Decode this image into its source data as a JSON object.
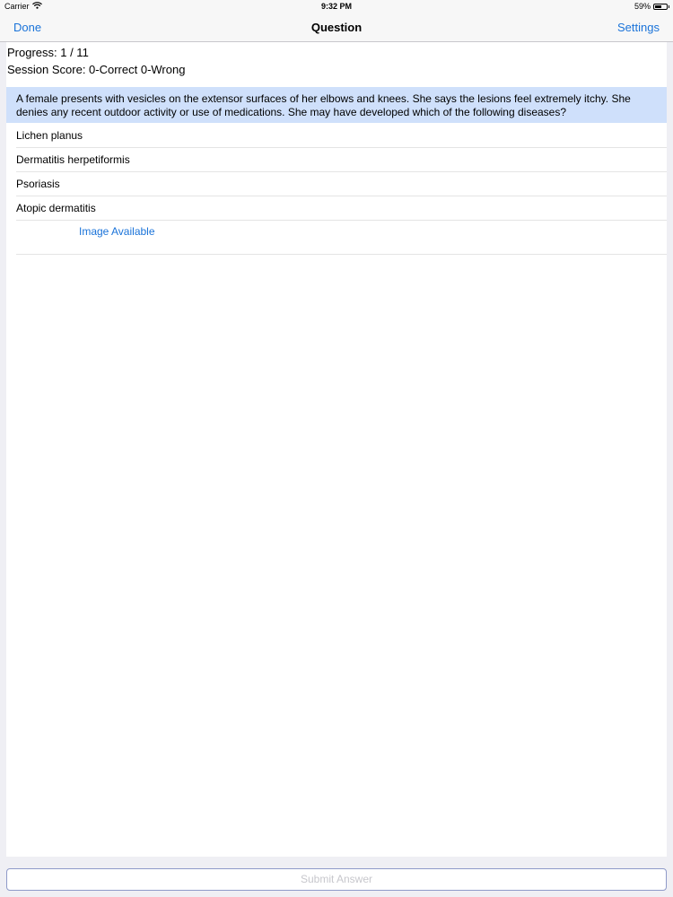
{
  "status": {
    "carrier": "Carrier",
    "time": "9:32 PM",
    "battery": "59%",
    "battery_level": 0.59
  },
  "nav": {
    "left_label": "Done",
    "title": "Question",
    "right_label": "Settings"
  },
  "session": {
    "progress": "Progress: 1 / 11",
    "score": "Session Score: 0-Correct 0-Wrong"
  },
  "question": {
    "text": "A female presents with vesicles on the extensor surfaces of her elbows and knees. She says the lesions feel extremely itchy. She denies any recent outdoor activity or use of medications. She may have developed which of the following diseases?"
  },
  "answers": [
    "Lichen planus",
    "Dermatitis herpetiformis",
    "Psoriasis",
    "Atopic dermatitis"
  ],
  "image_link": "Image Available",
  "submit_label": "Submit Answer",
  "colors": {
    "accent": "#1a73d9",
    "question_bg": "#cfe0fb"
  }
}
